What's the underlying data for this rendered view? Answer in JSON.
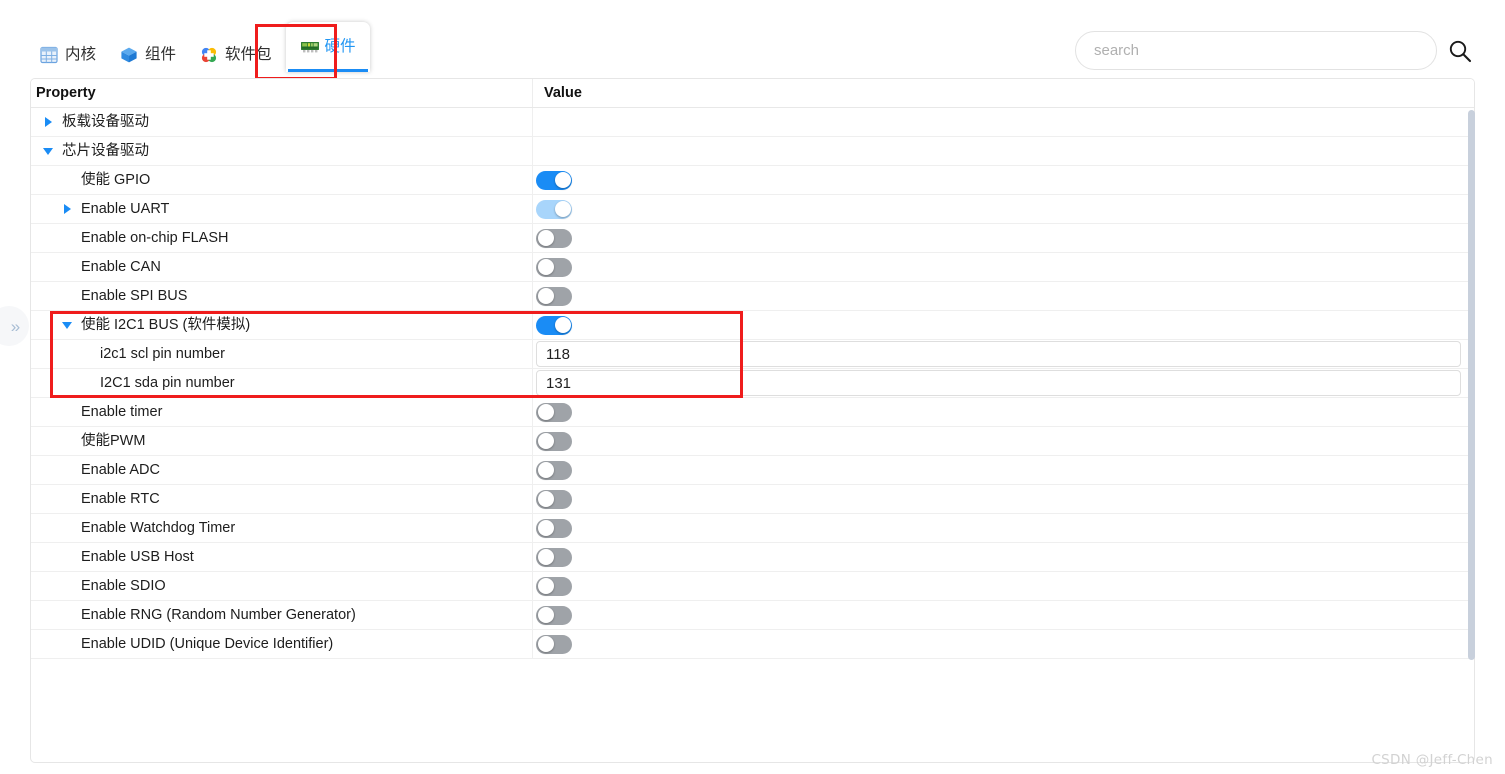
{
  "tabs": [
    {
      "label": "内核",
      "icon": "grid-icon",
      "active": false
    },
    {
      "label": "组件",
      "icon": "cube-icon",
      "active": false
    },
    {
      "label": "软件包",
      "icon": "clover-icon",
      "active": false
    },
    {
      "label": "硬件",
      "icon": "pcb-card-icon",
      "active": true
    }
  ],
  "search": {
    "placeholder": "search",
    "value": "",
    "icon": "search-icon"
  },
  "table": {
    "columns": [
      "Property",
      "Value"
    ],
    "rows": [
      {
        "label": "板载设备驱动",
        "indent": 0,
        "arrow": "right",
        "value_type": "none"
      },
      {
        "label": "芯片设备驱动",
        "indent": 0,
        "arrow": "down",
        "value_type": "none"
      },
      {
        "label": "使能 GPIO",
        "indent": 1,
        "arrow": "none",
        "value_type": "toggle",
        "toggle": "on"
      },
      {
        "label": "Enable UART",
        "indent": 1,
        "arrow": "right",
        "value_type": "toggle",
        "toggle": "partial"
      },
      {
        "label": "Enable on-chip FLASH",
        "indent": 1,
        "arrow": "none",
        "value_type": "toggle",
        "toggle": "off"
      },
      {
        "label": "Enable CAN",
        "indent": 1,
        "arrow": "none",
        "value_type": "toggle",
        "toggle": "off"
      },
      {
        "label": "Enable SPI BUS",
        "indent": 1,
        "arrow": "none",
        "value_type": "toggle",
        "toggle": "off"
      },
      {
        "label": "使能 I2C1 BUS (软件模拟)",
        "indent": 1,
        "arrow": "down",
        "value_type": "toggle",
        "toggle": "on"
      },
      {
        "label": "i2c1 scl pin number",
        "indent": 2,
        "arrow": "none",
        "value_type": "input",
        "value": "118"
      },
      {
        "label": "I2C1 sda pin number",
        "indent": 2,
        "arrow": "none",
        "value_type": "input",
        "value": "131"
      },
      {
        "label": "Enable timer",
        "indent": 1,
        "arrow": "none",
        "value_type": "toggle",
        "toggle": "off"
      },
      {
        "label": "使能PWM",
        "indent": 1,
        "arrow": "none",
        "value_type": "toggle",
        "toggle": "off"
      },
      {
        "label": "Enable ADC",
        "indent": 1,
        "arrow": "none",
        "value_type": "toggle",
        "toggle": "off"
      },
      {
        "label": "Enable RTC",
        "indent": 1,
        "arrow": "none",
        "value_type": "toggle",
        "toggle": "off"
      },
      {
        "label": "Enable Watchdog Timer",
        "indent": 1,
        "arrow": "none",
        "value_type": "toggle",
        "toggle": "off"
      },
      {
        "label": "Enable USB Host",
        "indent": 1,
        "arrow": "none",
        "value_type": "toggle",
        "toggle": "off"
      },
      {
        "label": "Enable SDIO",
        "indent": 1,
        "arrow": "none",
        "value_type": "toggle",
        "toggle": "off"
      },
      {
        "label": "Enable RNG (Random Number Generator)",
        "indent": 1,
        "arrow": "none",
        "value_type": "toggle",
        "toggle": "off"
      },
      {
        "label": "Enable UDID (Unique Device Identifier)",
        "indent": 1,
        "arrow": "none",
        "value_type": "toggle",
        "toggle": "off"
      }
    ]
  },
  "annotations": [
    {
      "name": "hardware-tab-highlight",
      "color": "#ef1c1c"
    },
    {
      "name": "i2c-block-highlight",
      "color": "#ef1c1c"
    }
  ],
  "sidebar_toggle": {
    "icon": "double-chevron-right-icon"
  },
  "scrollbar": {
    "name": "vertical-scrollbar"
  },
  "watermark": {
    "text": "CSDN @Jeff-Chen"
  },
  "colors": {
    "accent": "#1a8cf5",
    "toggle_on": "#1a8cf5",
    "toggle_partial": "#a8d5fb",
    "toggle_off": "#9fa3a8",
    "annotation_red": "#ef1c1c",
    "scrollbar": "#c8d0dc"
  }
}
